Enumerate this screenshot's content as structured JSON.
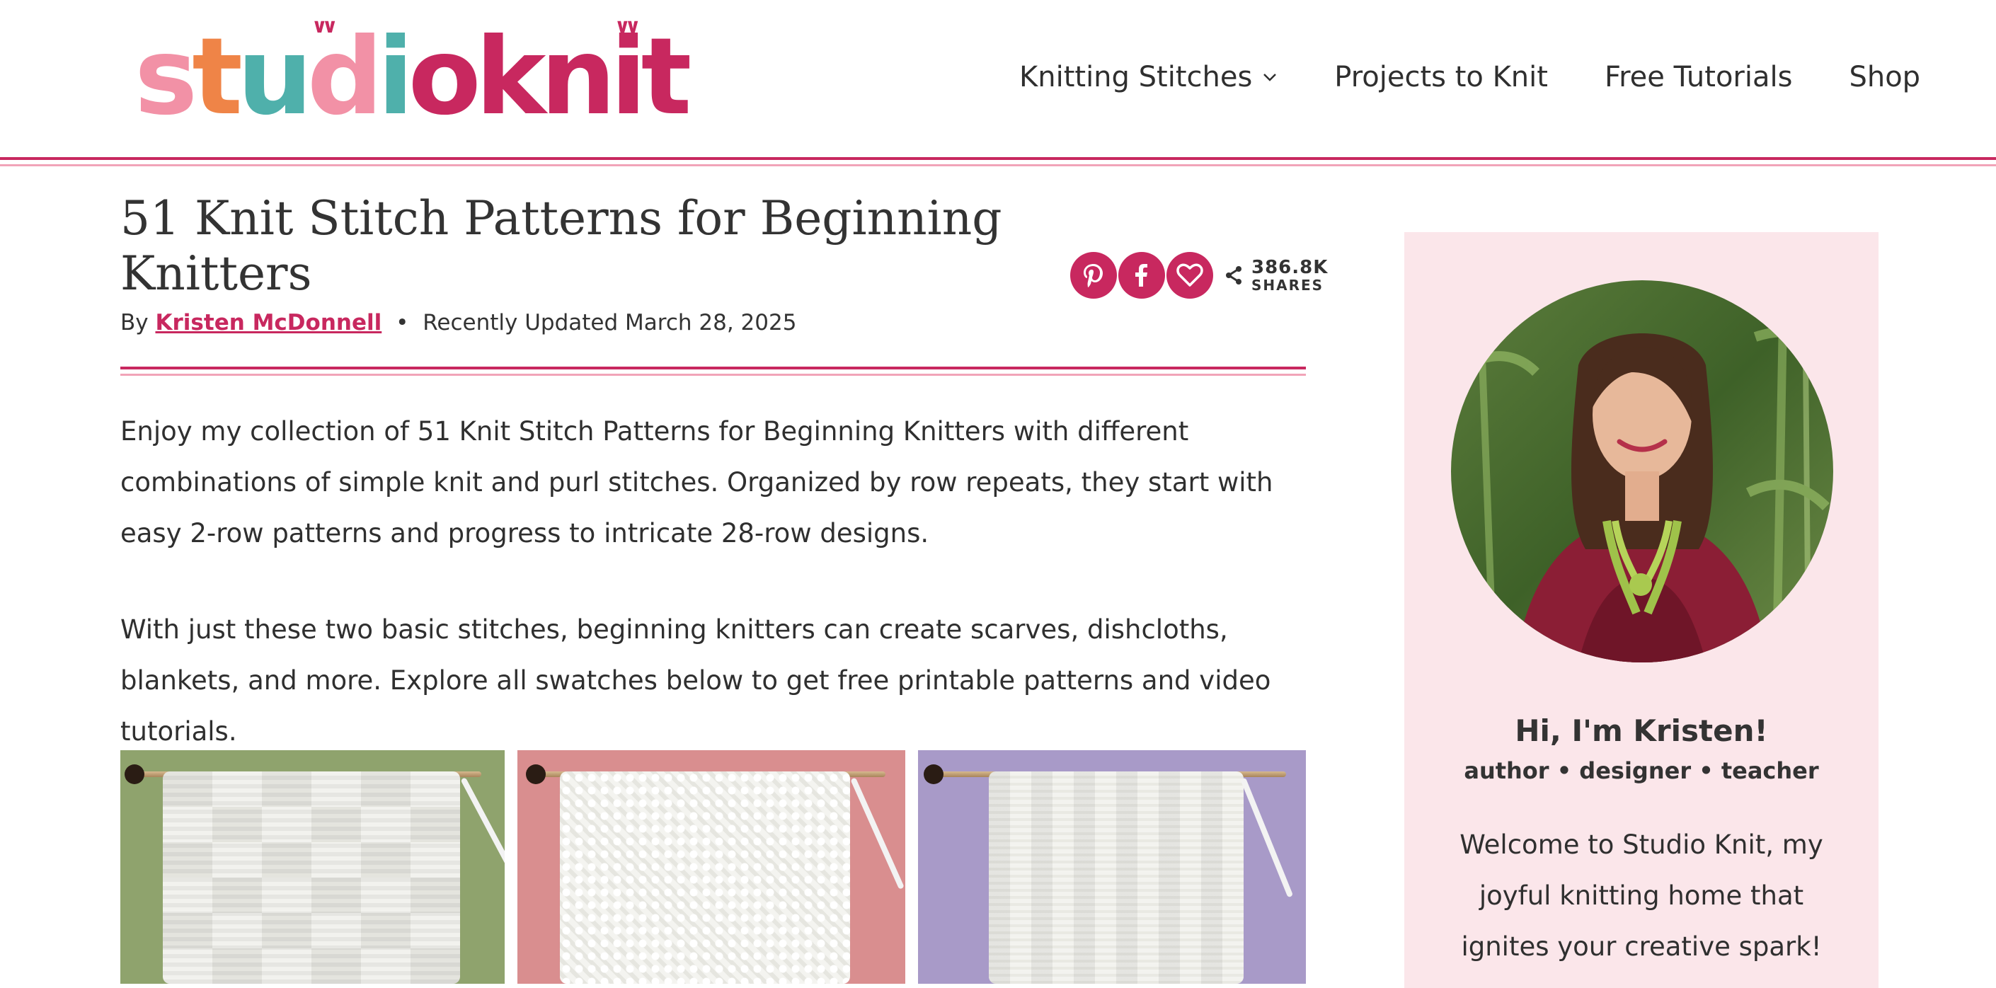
{
  "brand": {
    "logo_text": "studioknit",
    "letter_colors": [
      "#f291a6",
      "#ef8447",
      "#4fb0ab",
      "#f291a6",
      "#4fb0ab",
      "#c8285f",
      "#c8285f",
      "#c8285f",
      "#c8285f",
      "#c8285f"
    ],
    "accent": "#c8285f",
    "accent_light": "#f1a4b8"
  },
  "nav": {
    "items": [
      {
        "label": "Knitting Stitches",
        "has_dropdown": true
      },
      {
        "label": "Projects to Knit",
        "has_dropdown": false
      },
      {
        "label": "Free Tutorials",
        "has_dropdown": false
      },
      {
        "label": "Shop",
        "has_dropdown": false
      }
    ]
  },
  "article": {
    "title": "51 Knit Stitch Patterns for Beginning Knitters",
    "by_label": "By",
    "author": "Kristen McDonnell",
    "separator": "•",
    "updated": "Recently Updated March 28, 2025",
    "share": {
      "icons": [
        "pinterest-icon",
        "facebook-icon",
        "heart-icon",
        "share-icon"
      ],
      "count": "386.8K",
      "count_label": "SHARES"
    },
    "paragraphs": [
      "Enjoy my collection of 51 Knit Stitch Patterns for Beginning Knitters with different combinations of simple knit and purl stitches. Organized by row repeats, they start with easy 2-row patterns and progress to intricate 28-row designs.",
      "With just these two basic stitches, beginning knitters can create scarves, dishcloths, blankets, and more. Explore all swatches below to get free printable patterns and video tutorials."
    ],
    "swatch_backgrounds": [
      "#8fa36d",
      "#d98e8f",
      "#a89ac8"
    ]
  },
  "sidebar": {
    "greeting": "Hi, I'm Kristen!",
    "roles": "author • designer • teacher",
    "welcome": "Welcome to Studio Knit, my joyful knitting home that ignites your creative spark!",
    "background": "#fbe6ea"
  }
}
